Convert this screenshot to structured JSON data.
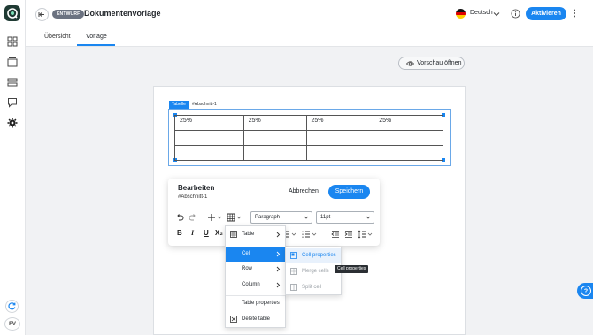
{
  "header": {
    "draft_badge": "ENTWURF",
    "title": "Dokumentenvorlage",
    "language": "Deutsch",
    "activate_label": "Aktivieren"
  },
  "tabs": [
    {
      "label": "Übersicht",
      "active": false
    },
    {
      "label": "Vorlage",
      "active": true
    }
  ],
  "preview_label": "Vorschau öffnen",
  "sidebar": {
    "avatar_initials": "FV",
    "icons": [
      "dashboard-icon",
      "inbox-icon",
      "list-icon",
      "chat-icon",
      "gear-icon"
    ]
  },
  "document": {
    "table_tag": "Tabelle",
    "anchor": "#Abschnitt-1",
    "table": [
      [
        "25%",
        "25%",
        "25%",
        "25%"
      ],
      [
        "",
        "",
        "",
        ""
      ],
      [
        "",
        "",
        "",
        ""
      ]
    ]
  },
  "edit_panel": {
    "title": "Bearbeiten",
    "subtitle": "#Abschnitt-1",
    "cancel_label": "Abbrechen",
    "save_label": "Speichern",
    "paragraph_select": "Paragraph",
    "font_size_select": "11pt",
    "bold": "B",
    "italic": "I",
    "underline": "U",
    "subscript": "X₂"
  },
  "table_menu": {
    "header_label": "Table",
    "items": [
      {
        "label": "Cell",
        "submenu": true,
        "highlighted": true
      },
      {
        "label": "Row",
        "submenu": true,
        "highlighted": false
      },
      {
        "label": "Column",
        "submenu": true,
        "highlighted": false
      },
      {
        "label": "Table properties",
        "submenu": false,
        "highlighted": false
      },
      {
        "label": "Delete table",
        "submenu": false,
        "highlighted": false
      }
    ]
  },
  "cell_submenu": {
    "items": [
      {
        "label": "Cell properties",
        "enabled": true,
        "highlighted": true
      },
      {
        "label": "Merge cells",
        "enabled": false,
        "highlighted": false
      },
      {
        "label": "Split cell",
        "enabled": false,
        "highlighted": false
      }
    ]
  },
  "tooltip": "Cell properties",
  "colors": {
    "accent": "#1a86f0",
    "logo": "#1f3a33",
    "draft_badge": "#6b7280"
  }
}
